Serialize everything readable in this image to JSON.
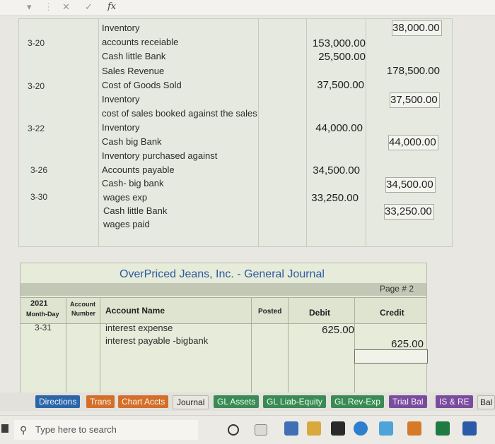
{
  "formula_bar": {
    "cancel_glyph": "✕",
    "confirm_glyph": "✓",
    "fx_label": "fx",
    "name_box_glyph": "▾"
  },
  "journal": {
    "entries": [
      {
        "date": "",
        "account": "Inventory",
        "debit": "",
        "credit": "38,000.00"
      },
      {
        "date": "3-20",
        "account": "accounts receiable",
        "debit": "153,000.00",
        "credit": ""
      },
      {
        "date": "",
        "account": "Cash little Bank",
        "debit": "25,500.00",
        "credit": ""
      },
      {
        "date": "",
        "account": "Sales Revenue",
        "debit": "",
        "credit": "178,500.00"
      },
      {
        "date": "3-20",
        "account": "Cost of Goods Sold",
        "debit": "37,500.00",
        "credit": ""
      },
      {
        "date": "",
        "account": "Inventory",
        "debit": "",
        "credit": "37,500.00"
      },
      {
        "date": "",
        "account": "cost of sales booked against the sales ma",
        "debit": "",
        "credit": ""
      },
      {
        "date": "3-22",
        "account": "Inventory",
        "debit": "44,000.00",
        "credit": ""
      },
      {
        "date": "",
        "account": "Cash big Bank",
        "debit": "",
        "credit": "44,000.00"
      },
      {
        "date": "",
        "account": "Inventory purchased against",
        "debit": "",
        "credit": ""
      },
      {
        "date": "3-26",
        "account": "Accounts payable",
        "debit": "34,500.00",
        "credit": ""
      },
      {
        "date": "",
        "account": "Cash- big bank",
        "debit": "",
        "credit": "34,500.00"
      },
      {
        "date": "3-30",
        "account": "wages exp",
        "debit": "33,250.00",
        "credit": ""
      },
      {
        "date": "",
        "account": "Cash little Bank",
        "debit": "",
        "credit": "33,250.00"
      },
      {
        "date": "",
        "account": "wages paid",
        "debit": "",
        "credit": ""
      }
    ]
  },
  "general_journal": {
    "title": "OverPriced Jeans, Inc.  -  General Journal",
    "page": "Page # 2",
    "headers": {
      "year": "2021",
      "month_day": "Month-Day",
      "account": "Account",
      "number": "Number",
      "account_name": "Account Name",
      "posted": "Posted",
      "debit": "Debit",
      "credit": "Credit"
    },
    "rows": [
      {
        "date": "3-31",
        "account": "interest expense",
        "debit": "625.00",
        "credit": ""
      },
      {
        "date": "",
        "account": "interest payable -bigbank",
        "debit": "",
        "credit": "625.00"
      }
    ]
  },
  "sheet_tabs": [
    "Directions",
    "Trans",
    "Chart Accts",
    "Journal",
    "GL Assets",
    "GL Liab-Equity",
    "GL Rev-Exp",
    "Trial Bal",
    "IS & RE",
    "Bal"
  ],
  "taskbar": {
    "search_placeholder": "Type here to search"
  }
}
